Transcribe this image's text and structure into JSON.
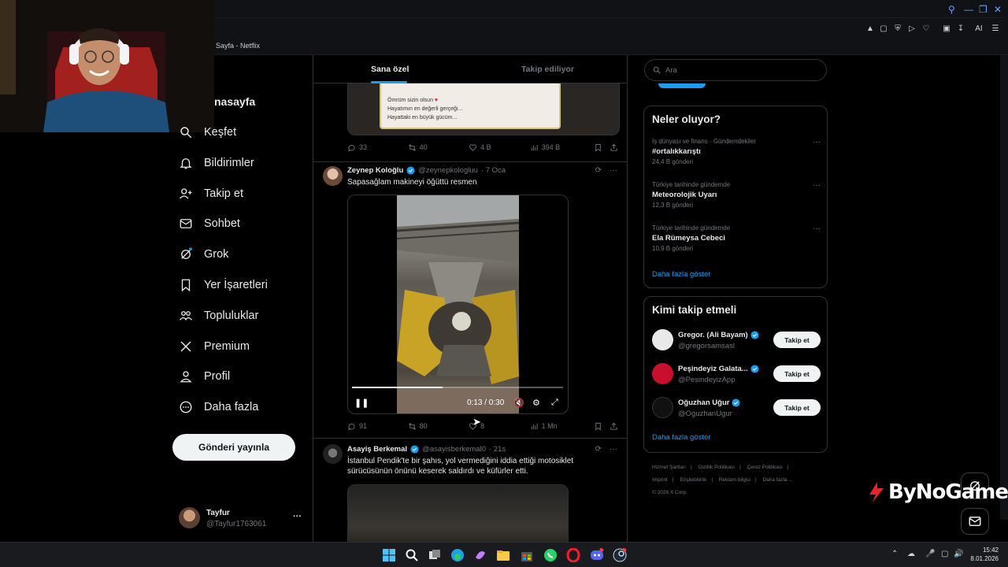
{
  "browser": {
    "tab_title": "Sayfa - Netflix"
  },
  "nav": {
    "title": "nasayfa",
    "items": [
      {
        "label": "Keşfet",
        "icon": "search-icon"
      },
      {
        "label": "Bildirimler",
        "icon": "bell-icon"
      },
      {
        "label": "Takip et",
        "icon": "person-add-icon"
      },
      {
        "label": "Sohbet",
        "icon": "mail-icon"
      },
      {
        "label": "Grok",
        "icon": "grok-icon"
      },
      {
        "label": "Yer İşaretleri",
        "icon": "bookmark-icon"
      },
      {
        "label": "Topluluklar",
        "icon": "people-icon"
      },
      {
        "label": "Premium",
        "icon": "x-logo-icon"
      },
      {
        "label": "Profil",
        "icon": "user-icon"
      },
      {
        "label": "Daha fazla",
        "icon": "more-circle-icon"
      }
    ],
    "post_button": "Gönderi yayınla",
    "profile": {
      "name": "Tayfur",
      "handle": "@Tayfur1763061",
      "more": "···"
    }
  },
  "feed": {
    "tabs": {
      "active": "Sana özel",
      "inactive": "Takip ediliyor"
    },
    "note_lines": [
      "Ömrüm sizin olsun",
      "Hayatımın en değerli gerçeği...",
      "Hayattaki en büyük gücüm..."
    ],
    "post0_actions": {
      "replies": "33",
      "reposts": "40",
      "likes": "4 B",
      "views": "394 B"
    },
    "post1": {
      "name": "Zeynep Koloğlu",
      "handle": "@zeynepkologluu",
      "time": "· 7 Oca",
      "text": "Sapasağlam makineyi öğüttü resmen",
      "video_time": "0:13 / 0:30",
      "progress": 0.43,
      "actions": {
        "replies": "91",
        "reposts": "80",
        "likes": "8",
        "views": "1 Mn"
      }
    },
    "post2": {
      "name": "Asayiş Berkemal",
      "handle": "@asayisberkemal0",
      "time": "· 21s",
      "text": "İstanbul Pendik'te bir şahıs, yol vermediğini iddia ettiği motosiklet sürücüsünün önünü keserek saldırdı ve küfürler etti."
    }
  },
  "right": {
    "search_placeholder": "Ara",
    "trends_title": "Neler oluyor?",
    "trends": [
      {
        "context": "İş dünyası ve finans · Gündemdekiler",
        "title": "#ortalıkkarıştı",
        "count": "24,4 B gönderi"
      },
      {
        "context": "Türkiye tarihinde gündemde",
        "title": "Meteorolojik Uyarı",
        "count": "12,3 B gönderi"
      },
      {
        "context": "Türkiye tarihinde gündemde",
        "title": "Ela Rümeysa Cebeci",
        "count": "10,9 B gönderi"
      }
    ],
    "trends_more": "Daha fazla göster",
    "who_title": "Kimi takip etmeli",
    "who": [
      {
        "name": "Gregor. (Ali Bayam)",
        "handle": "@gregorsamsasl",
        "button": "Takip et",
        "color": "#e9e9e9"
      },
      {
        "name": "Peşindeyiz Galata...",
        "handle": "@PesindeyizApp",
        "button": "Takip et",
        "color": "#c8102e"
      },
      {
        "name": "Oğuzhan Uğur",
        "handle": "@OguzhanUgur",
        "button": "Takip et",
        "color": "#111111"
      }
    ],
    "who_more": "Daha fazla göster",
    "footer": [
      "Hizmet Şartları",
      "|",
      "Gizlilik Politikası",
      "|",
      "Çerez Politikası",
      "|",
      "Imprint",
      "|",
      "Erişilebilirlik",
      "|",
      "Reklam bilgisi",
      "|",
      "Daha fazla ...",
      "© 2026 X Corp."
    ]
  },
  "watermark": "ByNoGame",
  "taskbar": {
    "time": "15:42",
    "date": "8.01.2026"
  },
  "colors": {
    "accent": "#1d9bf0",
    "background": "#000000",
    "border": "#2f3336",
    "muted": "#71767b"
  }
}
